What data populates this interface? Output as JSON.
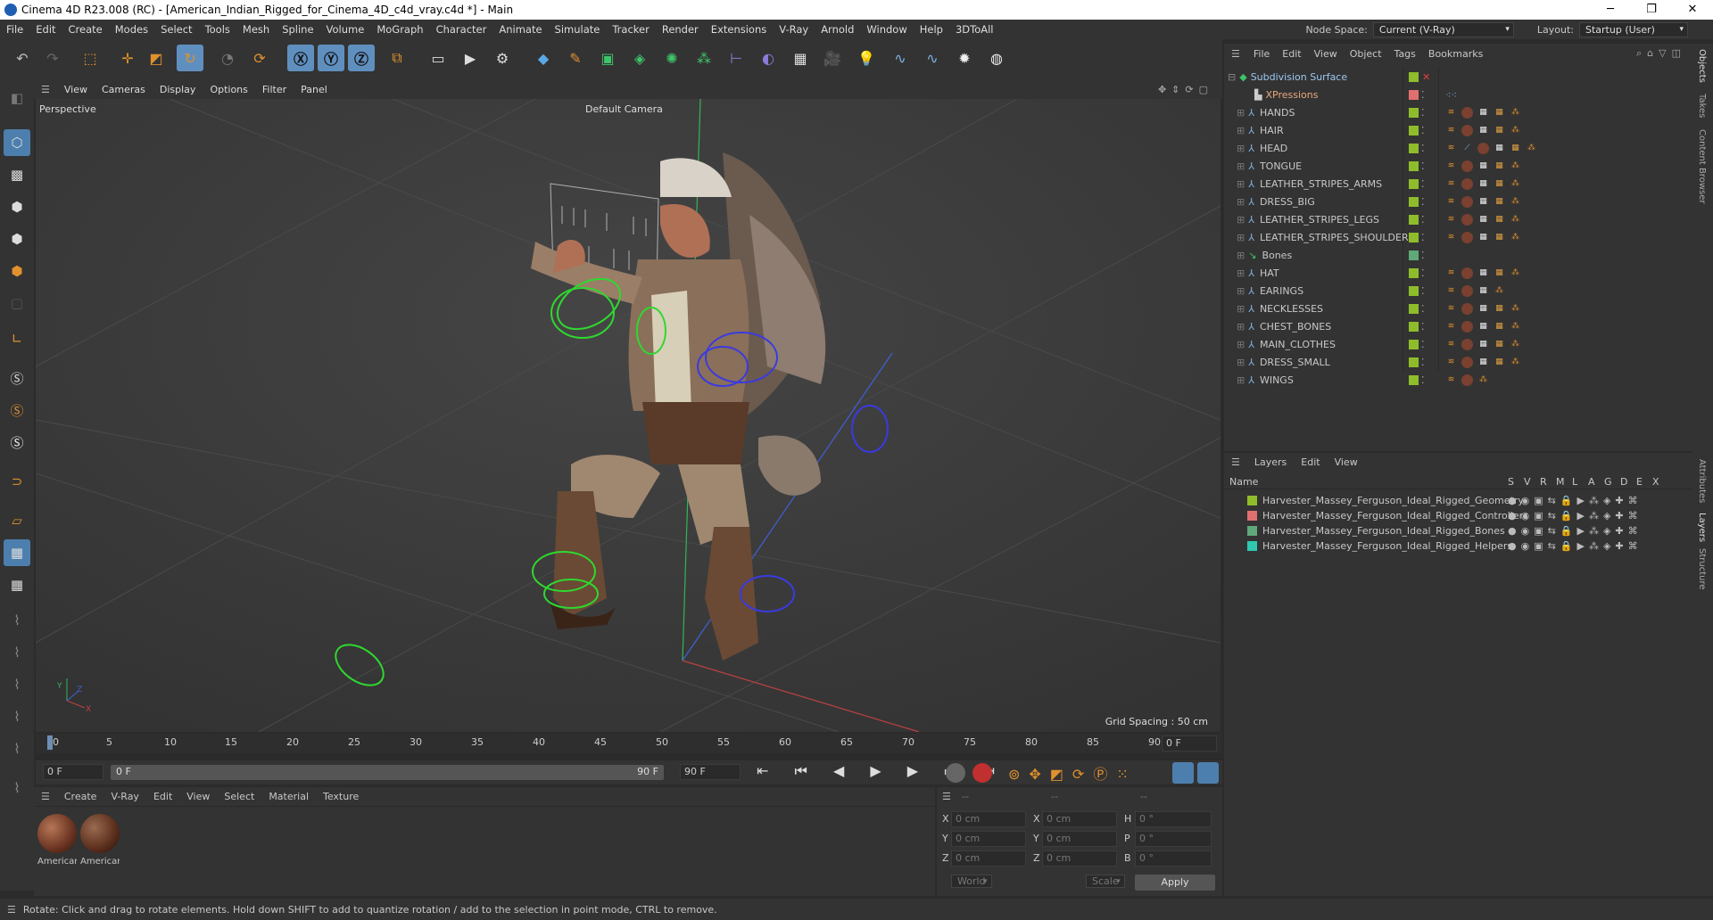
{
  "window": {
    "title": "Cinema 4D R23.008 (RC) - [American_Indian_Rigged_for_Cinema_4D_c4d_vray.c4d *] - Main",
    "minimize": "─",
    "maximize": "❐",
    "close": "✕"
  },
  "menubar": {
    "items": [
      "File",
      "Edit",
      "Create",
      "Modes",
      "Select",
      "Tools",
      "Mesh",
      "Spline",
      "Volume",
      "MoGraph",
      "Character",
      "Animate",
      "Simulate",
      "Tracker",
      "Render",
      "Extensions",
      "V-Ray",
      "Arnold",
      "Window",
      "Help",
      "3DToAll"
    ],
    "node_space_label": "Node Space:",
    "node_space_value": "Current (V-Ray)",
    "layout_label": "Layout:",
    "layout_value": "Startup (User)"
  },
  "viewport": {
    "menu": [
      "View",
      "Cameras",
      "Display",
      "Options",
      "Filter",
      "Panel"
    ],
    "label": "Perspective",
    "camera": "Default Camera",
    "grid_spacing": "Grid Spacing : 50 cm",
    "axis_x": "X",
    "axis_y": "Y",
    "axis_z": "Z"
  },
  "timeline": {
    "ticks": [
      "0",
      "5",
      "10",
      "15",
      "20",
      "25",
      "30",
      "35",
      "40",
      "45",
      "50",
      "55",
      "60",
      "65",
      "70",
      "75",
      "80",
      "85",
      "90"
    ],
    "end_field": "0 F"
  },
  "transport": {
    "current_frame": "0 F",
    "slider_start": "0 F",
    "slider_end": "90 F",
    "max_frame": "90 F"
  },
  "materials": {
    "menu": [
      "Create",
      "V-Ray",
      "Edit",
      "View",
      "Select",
      "Material",
      "Texture"
    ],
    "items": [
      {
        "label": "Americar"
      },
      {
        "label": "Americar"
      }
    ]
  },
  "coords": {
    "headers": [
      "--",
      "--",
      "--"
    ],
    "rows": [
      {
        "a": "X",
        "av": "0 cm",
        "b": "X",
        "bv": "0 cm",
        "c": "H",
        "cv": "0 °"
      },
      {
        "a": "Y",
        "av": "0 cm",
        "b": "Y",
        "bv": "0 cm",
        "c": "P",
        "cv": "0 °"
      },
      {
        "a": "Z",
        "av": "0 cm",
        "b": "Z",
        "bv": "0 cm",
        "c": "B",
        "cv": "0 °"
      }
    ],
    "mode1": "World",
    "mode2": "Scale",
    "apply": "Apply"
  },
  "status": "Rotate: Click and drag to rotate elements. Hold down SHIFT to add to quantize rotation / add to the selection in point mode, CTRL to remove.",
  "objects": {
    "menu": [
      "File",
      "Edit",
      "View",
      "Object",
      "Tags",
      "Bookmarks"
    ],
    "items": [
      {
        "name": "Subdivision Surface",
        "color": "#8fbc2a",
        "indent": 0
      },
      {
        "name": "XPressions",
        "color": "#e07070",
        "indent": 1
      },
      {
        "name": "HANDS",
        "color": "#8fbc2a",
        "indent": 1
      },
      {
        "name": "HAIR",
        "color": "#8fbc2a",
        "indent": 1
      },
      {
        "name": "HEAD",
        "color": "#8fbc2a",
        "indent": 1
      },
      {
        "name": "TONGUE",
        "color": "#8fbc2a",
        "indent": 1
      },
      {
        "name": "LEATHER_STRIPES_ARMS",
        "color": "#8fbc2a",
        "indent": 1
      },
      {
        "name": "DRESS_BIG",
        "color": "#8fbc2a",
        "indent": 1
      },
      {
        "name": "LEATHER_STRIPES_LEGS",
        "color": "#8fbc2a",
        "indent": 1
      },
      {
        "name": "LEATHER_STRIPES_SHOULDERS",
        "color": "#8fbc2a",
        "indent": 1
      },
      {
        "name": "Bones",
        "color": "#5fa87a",
        "indent": 1
      },
      {
        "name": "HAT",
        "color": "#8fbc2a",
        "indent": 1
      },
      {
        "name": "EARINGS",
        "color": "#8fbc2a",
        "indent": 1
      },
      {
        "name": "NECKLESSES",
        "color": "#8fbc2a",
        "indent": 1
      },
      {
        "name": "CHEST_BONES",
        "color": "#8fbc2a",
        "indent": 1
      },
      {
        "name": "MAIN_CLOTHES",
        "color": "#8fbc2a",
        "indent": 1
      },
      {
        "name": "DRESS_SMALL",
        "color": "#8fbc2a",
        "indent": 1
      },
      {
        "name": "WINGS",
        "color": "#8fbc2a",
        "indent": 1
      }
    ]
  },
  "layers": {
    "menu": [
      "Layers",
      "Edit",
      "View"
    ],
    "columns": [
      "Name",
      "S",
      "V",
      "R",
      "M",
      "L",
      "A",
      "G",
      "D",
      "E",
      "X"
    ],
    "items": [
      {
        "name": "Harvester_Massey_Ferguson_Ideal_Rigged_Geometry",
        "color": "#8fbc2a"
      },
      {
        "name": "Harvester_Massey_Ferguson_Ideal_Rigged_Controllers",
        "color": "#e07070"
      },
      {
        "name": "Harvester_Massey_Ferguson_Ideal_Rigged_Bones",
        "color": "#5fa87a"
      },
      {
        "name": "Harvester_Massey_Ferguson_Ideal_Rigged_Helpers",
        "color": "#2fc8b0"
      }
    ]
  },
  "side_tabs": {
    "objects": "Objects",
    "takes": "Takes",
    "content": "Content Browser",
    "attributes": "Attributes",
    "layers": "Layers",
    "structure": "Structure"
  }
}
